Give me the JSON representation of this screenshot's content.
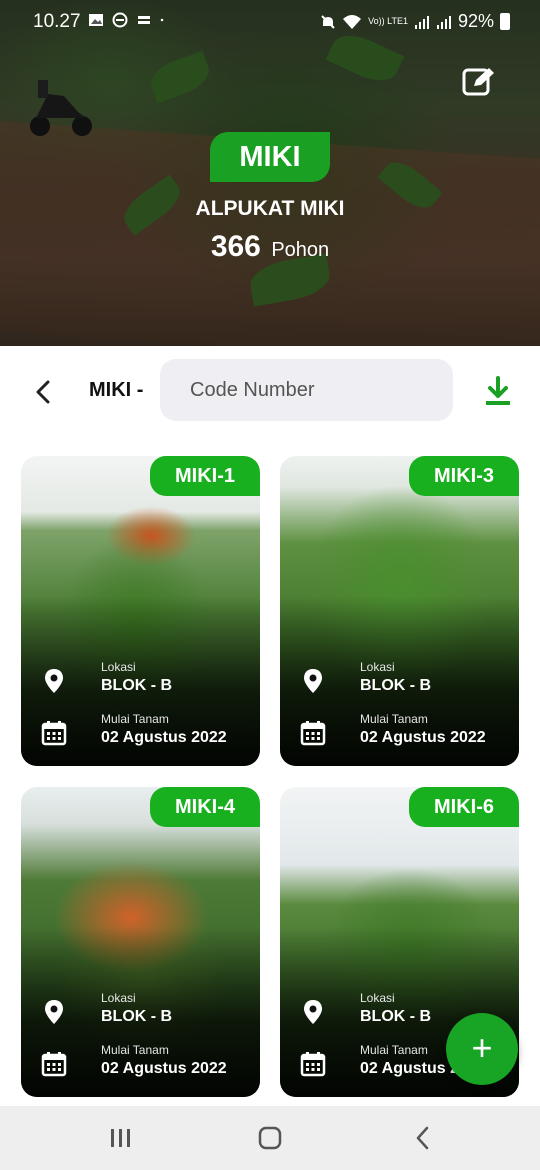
{
  "status_bar": {
    "time": "10.27",
    "battery": "92%",
    "network": "Vo)) LTE1",
    "icons_left": [
      "image-icon",
      "do-not-disturb-icon",
      "quran-app-icon",
      "dot-icon"
    ],
    "icons_right": [
      "mute-icon",
      "wifi-icon",
      "signal-icon",
      "signal-icon",
      "battery-icon"
    ]
  },
  "header": {
    "badge": "MIKI",
    "title": "ALPUKAT MIKI",
    "count": "366",
    "count_unit": "Pohon"
  },
  "toolbar": {
    "prefix": "MIKI -",
    "search_placeholder": "Code Number",
    "search_value": ""
  },
  "cards": [
    {
      "code": "MIKI-1",
      "location_label": "Lokasi",
      "location": "BLOK - B",
      "date_label": "Mulai Tanam",
      "date": "02 Agustus 2022"
    },
    {
      "code": "MIKI-3",
      "location_label": "Lokasi",
      "location": "BLOK - B",
      "date_label": "Mulai Tanam",
      "date": "02 Agustus 2022"
    },
    {
      "code": "MIKI-4",
      "location_label": "Lokasi",
      "location": "BLOK - B",
      "date_label": "Mulai Tanam",
      "date": "02 Agustus 2022"
    },
    {
      "code": "MIKI-6",
      "location_label": "Lokasi",
      "location": "BLOK - B",
      "date_label": "Mulai Tanam",
      "date": "02 Agustus 202"
    }
  ],
  "fab": {
    "label": "+"
  },
  "colors": {
    "accent": "#18a425",
    "badge": "#18b01f",
    "search_bg": "#eeeef3",
    "nav_bg": "#eeeeee"
  }
}
